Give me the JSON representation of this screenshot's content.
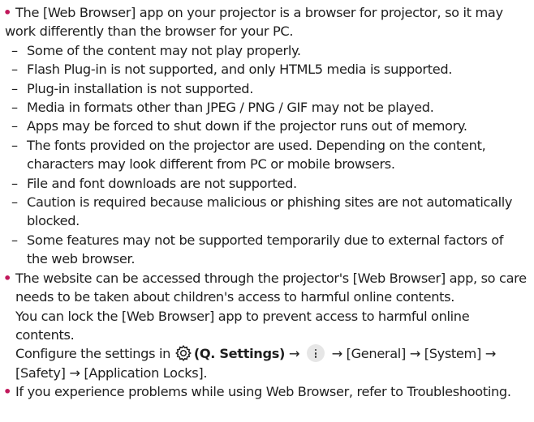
{
  "colors": {
    "bullet": "#c1185b",
    "text": "#1f1f1f",
    "more_icon_bg": "#e6e6e6"
  },
  "bullets": [
    {
      "lines": [
        "The [Web Browser] app on your projector is a browser for projector, so it may",
        "work differently than the browser for your PC."
      ],
      "subitems": [
        [
          "Some of the content may not play properly."
        ],
        [
          "Flash Plug-in is not supported, and only HTML5 media is supported."
        ],
        [
          "Plug-in installation is not supported."
        ],
        [
          "Media in formats other than JPEG / PNG / GIF may not be played."
        ],
        [
          "Apps may be forced to shut down if the projector runs out of memory."
        ],
        [
          "The fonts provided on the projector are used. Depending on the content,",
          "characters may look different from PC or mobile browsers."
        ],
        [
          "File and font downloads are not supported."
        ],
        [
          "Caution is required because malicious or phishing sites are not automatically",
          "blocked."
        ],
        [
          "Some features may not be supported temporarily due to external factors of",
          "the web browser."
        ]
      ]
    },
    {
      "lines": [
        "The website can be accessed through the projector's [Web Browser] app, so care",
        "needs to be taken about children's access to harmful online contents.",
        "You can lock the [Web Browser] app to prevent access to harmful online",
        "contents."
      ],
      "config": {
        "prefix": "Configure the settings in",
        "settings_icon": "gear-icon",
        "settings_label": "(Q. Settings)",
        "arrow": "→",
        "more_icon": "more-vertical-icon",
        "after_more": "→ [General] → [System] →",
        "second_line": "[Safety] → [Application Locks]."
      }
    },
    {
      "lines": [
        "If you experience problems while using Web Browser, refer to Troubleshooting."
      ]
    }
  ],
  "glyphs": {
    "bullet": "•",
    "dash": "–"
  }
}
